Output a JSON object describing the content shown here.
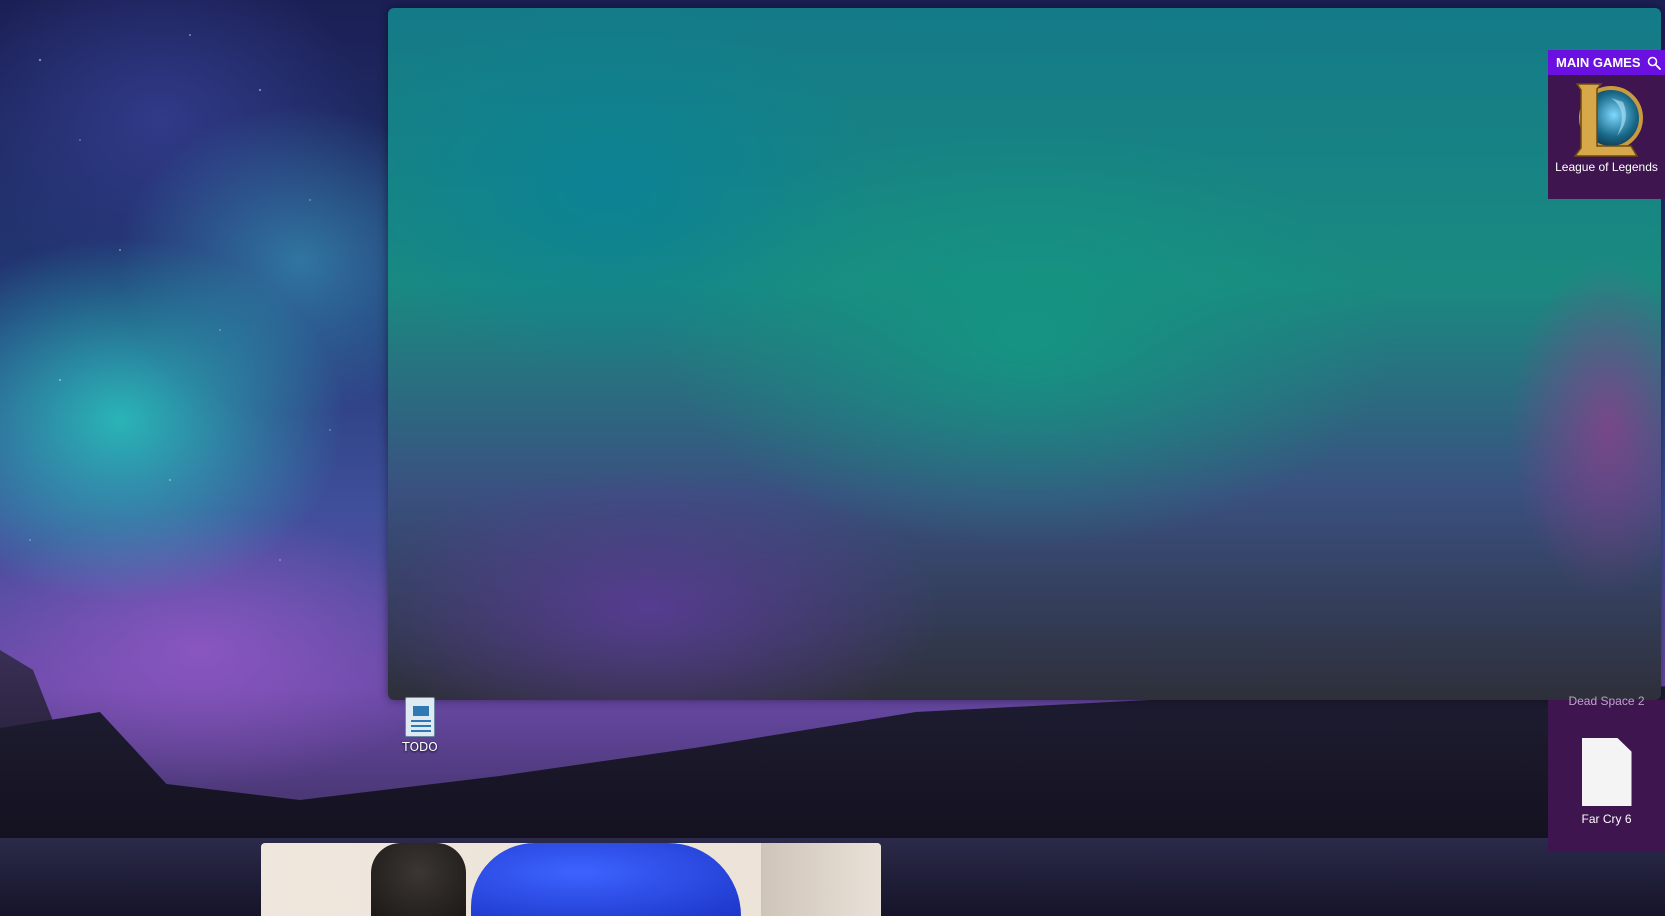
{
  "desktop": {
    "icons": [
      {
        "label": "TODO",
        "icon": "document-icon"
      }
    ]
  },
  "games_panel": {
    "title": "MAIN GAMES",
    "search_icon": "search-icon",
    "tiles": [
      {
        "label": "League of Legends",
        "icon": "league-of-legends-logo"
      }
    ]
  },
  "games_panel_lower": {
    "tiles": [
      {
        "label": "Dead Space 2"
      },
      {
        "label": "Far Cry 6",
        "icon": "blank-file-icon"
      }
    ]
  },
  "colors": {
    "panel_header": "#6a10e0",
    "panel_bg": "#3e154f"
  }
}
